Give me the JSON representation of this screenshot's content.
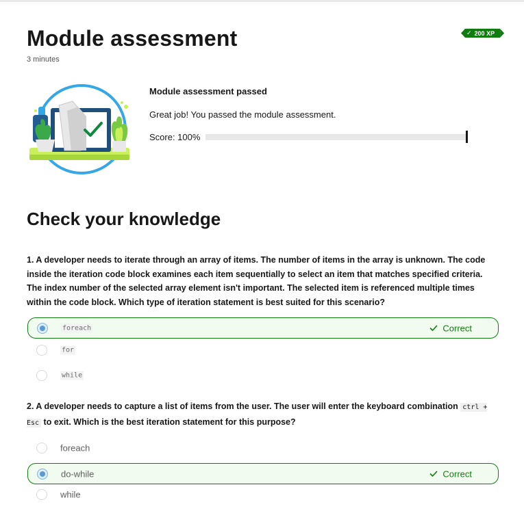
{
  "header": {
    "title": "Module assessment",
    "duration": "3 minutes",
    "xp": "200 XP"
  },
  "result": {
    "title": "Module assessment passed",
    "message": "Great job! You passed the module assessment.",
    "score_label": "Score: 100%",
    "score_fraction": 1.0
  },
  "section": {
    "title": "Check your knowledge"
  },
  "questions": [
    {
      "text": "1. A developer needs to iterate through an array of items. The number of items in the array is unknown. The code inside the iteration code block examines each item sequentially to select an item that matches specified criteria. The index number of the selected array element isn't important. The selected item is referenced multiple times within the code block. Which type of iteration statement is best suited for this scenario?",
      "options": [
        {
          "label": "foreach",
          "selected": true,
          "status": "Correct"
        },
        {
          "label": "for"
        },
        {
          "label": "while"
        }
      ]
    },
    {
      "text_before": "2. A developer needs to capture a list of items from the user. The user will enter the keyboard combination",
      "kbd": "ctrl + Esc",
      "text_after": "to exit. Which is the best iteration statement for this purpose?",
      "options": [
        {
          "label": "foreach"
        },
        {
          "label": "do-while",
          "selected": true,
          "status": "Correct"
        },
        {
          "label": "while"
        }
      ]
    }
  ],
  "colors": {
    "accent_green": "#107c10",
    "selected_bg": "#f1fbef",
    "radio_blue": "#5b9bd5"
  }
}
